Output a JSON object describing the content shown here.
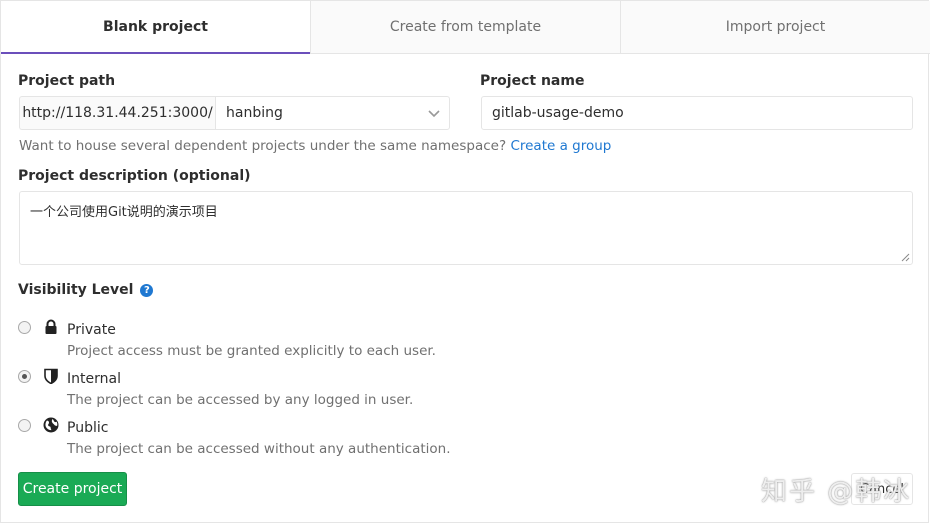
{
  "tabs": [
    {
      "label": "Blank project",
      "active": true
    },
    {
      "label": "Create from template",
      "active": false
    },
    {
      "label": "Import project",
      "active": false
    }
  ],
  "form": {
    "project_path_label": "Project path",
    "path_prefix": "http://118.31.44.251:3000/",
    "namespace_value": "hanbing",
    "project_name_label": "Project name",
    "project_name_value": "gitlab-usage-demo",
    "help_text": "Want to house several dependent projects under the same namespace?",
    "help_link": "Create a group",
    "description_label": "Project description (optional)",
    "description_value": "一个公司使用Git说明的演示项目",
    "visibility_label": "Visibility Level",
    "help_icon_glyph": "?"
  },
  "visibility": [
    {
      "title": "Private",
      "description": "Project access must be granted explicitly to each user.",
      "icon": "lock-icon",
      "checked": false
    },
    {
      "title": "Internal",
      "description": "The project can be accessed by any logged in user.",
      "icon": "shield-icon",
      "checked": true
    },
    {
      "title": "Public",
      "description": "The project can be accessed without any authentication.",
      "icon": "globe-icon",
      "checked": false
    }
  ],
  "buttons": {
    "create": "Create project",
    "cancel": "Cancel"
  },
  "watermark": "知乎 @韩冰",
  "colors": {
    "accent_tab": "#6b4fbb",
    "success": "#1aaa55",
    "link": "#1f78d1"
  }
}
